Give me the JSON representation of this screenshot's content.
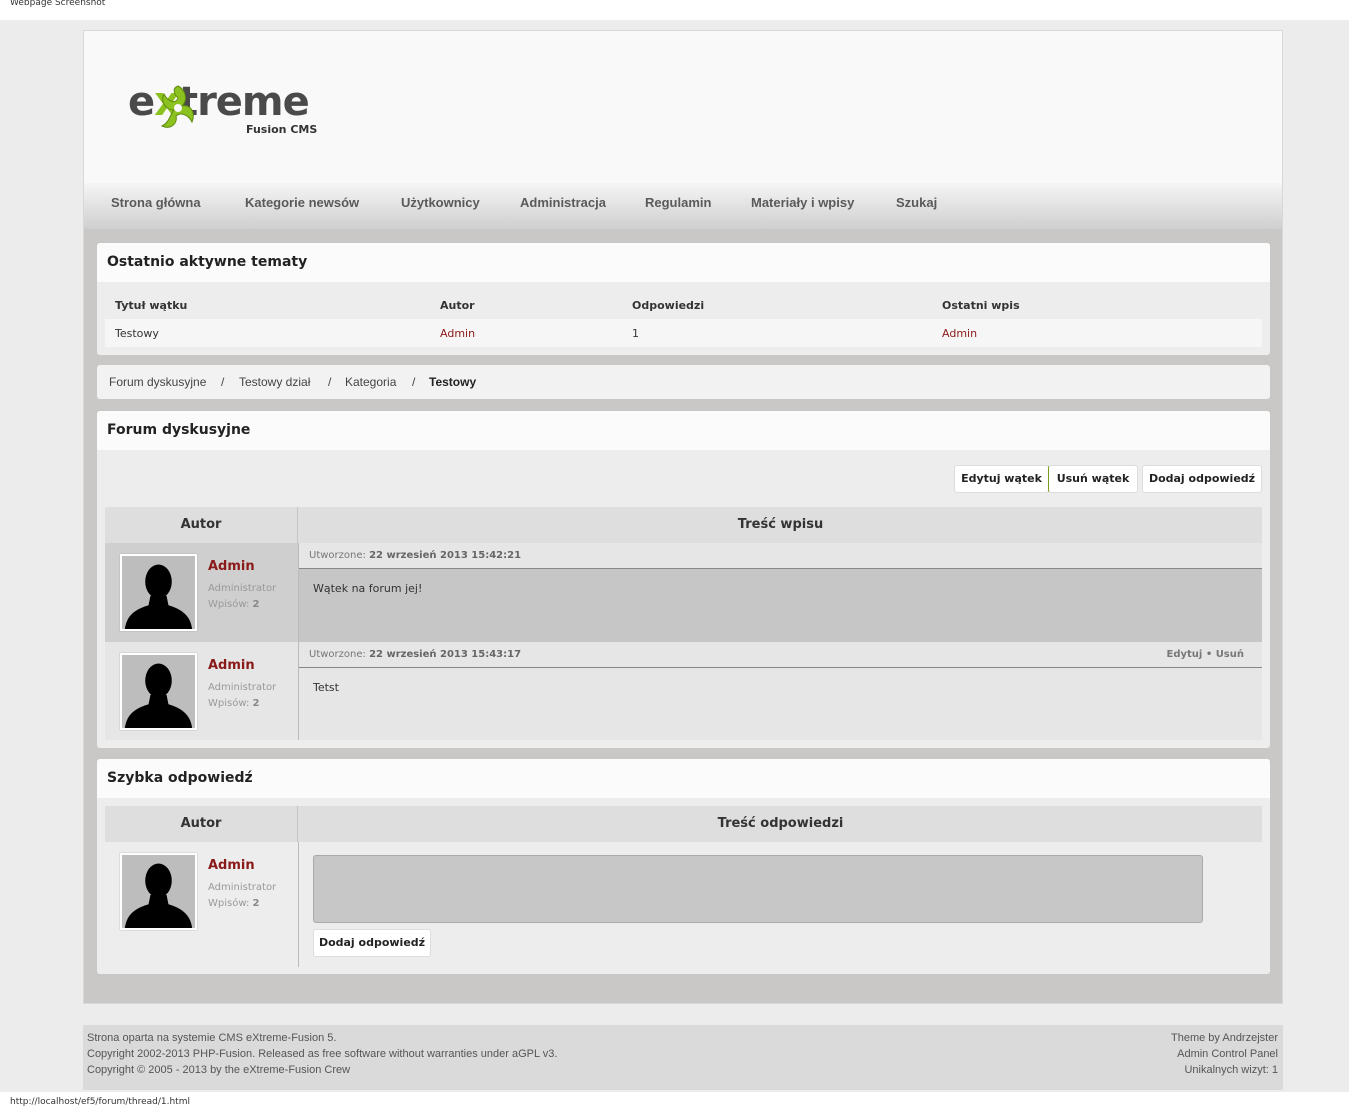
{
  "screenshot_label": "Webpage Screenshot",
  "status_url": "http://localhost/ef5/forum/thread/1.html",
  "logo": {
    "text_pre": "e",
    "text_x": "x",
    "text_post": "treme",
    "sub": "Fusion CMS"
  },
  "nav": [
    "Strona główna",
    "Kategorie newsów",
    "Użytkownicy",
    "Administracja",
    "Regulamin",
    "Materiały i wpisy",
    "Szukaj"
  ],
  "recent": {
    "title": "Ostatnio aktywne tematy",
    "headers": [
      "Tytuł wątku",
      "Autor",
      "Odpowiedzi",
      "Ostatni wpis"
    ],
    "row": {
      "title": "Testowy",
      "author": "Admin",
      "replies": "1",
      "last": "Admin"
    }
  },
  "breadcrumb": {
    "items": [
      "Forum dyskusyjne",
      "Testowy dział",
      "Kategoria"
    ],
    "current": "Testowy",
    "sep": "/"
  },
  "forum": {
    "title": "Forum dyskusyjne",
    "buttons": {
      "edit": "Edytuj wątek",
      "delete": "Usuń wątek",
      "reply": "Dodaj odpowiedź"
    },
    "col_author": "Autor",
    "col_content": "Treść wpisu",
    "posts": [
      {
        "author": "Admin",
        "role": "Administrator",
        "count_label": "Wpisów:",
        "count": "2",
        "created_label": "Utworzone:",
        "created": "22 wrzesień 2013 15:42:21",
        "text": "Wątek na forum jej!",
        "actions": ""
      },
      {
        "author": "Admin",
        "role": "Administrator",
        "count_label": "Wpisów:",
        "count": "2",
        "created_label": "Utworzone:",
        "created": "22 wrzesień 2013 15:43:17",
        "text": "Tetst",
        "actions": "Edytuj  •  Usuń"
      }
    ]
  },
  "quick": {
    "title": "Szybka odpowiedź",
    "col_author": "Autor",
    "col_content": "Treść odpowiedzi",
    "author": "Admin",
    "role": "Administrator",
    "count_label": "Wpisów:",
    "count": "2",
    "submit": "Dodaj odpowiedź"
  },
  "footer": {
    "left": [
      "Strona oparta na systemie CMS eXtreme-Fusion 5.",
      "Copyright 2002-2013 PHP-Fusion. Released as free software without warranties under aGPL v3.",
      "Copyright © 2005 - 2013 by the eXtreme-Fusion Crew"
    ],
    "right": [
      "Theme by Andrzejster",
      "Admin Control Panel",
      "Unikalnych wizyt: 1"
    ]
  }
}
